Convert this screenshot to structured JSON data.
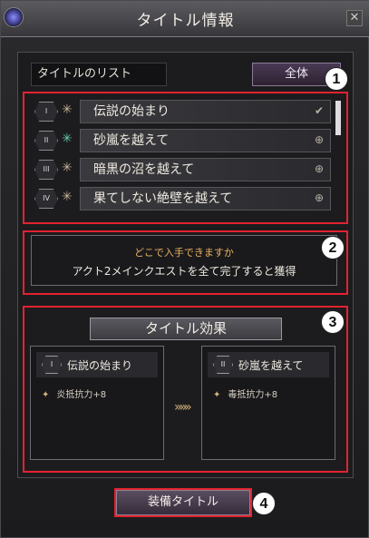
{
  "window": {
    "title": "タイトル情報",
    "close_label": "✕"
  },
  "list": {
    "label": "タイトルのリスト",
    "filter_label": "全体",
    "items": [
      {
        "badge": "I",
        "name": "伝説の始まり",
        "state": "✔"
      },
      {
        "badge": "II",
        "name": "砂嵐を越えて",
        "state": "⊕"
      },
      {
        "badge": "III",
        "name": "暗黒の沼を越えて",
        "state": "⊕"
      },
      {
        "badge": "IV",
        "name": "果てしない絶壁を越えて",
        "state": "⊕"
      }
    ]
  },
  "acquisition": {
    "heading": "どこで入手できますか",
    "text": "アクト2メインクエストを全て完了すると獲得"
  },
  "effect": {
    "title": "タイトル効果",
    "current": {
      "badge": "I",
      "name": "伝説の始まり",
      "effect": "炎抵抗力+8"
    },
    "next": {
      "badge": "II",
      "name": "砂嵐を越えて",
      "effect": "毒抵抗力+8"
    },
    "arrow": "»»»"
  },
  "equip_label": "装備タイトル",
  "markers": [
    "1",
    "2",
    "3",
    "4"
  ],
  "colors": {
    "highlight": "#e3222f",
    "accent": "#8a7a96"
  }
}
